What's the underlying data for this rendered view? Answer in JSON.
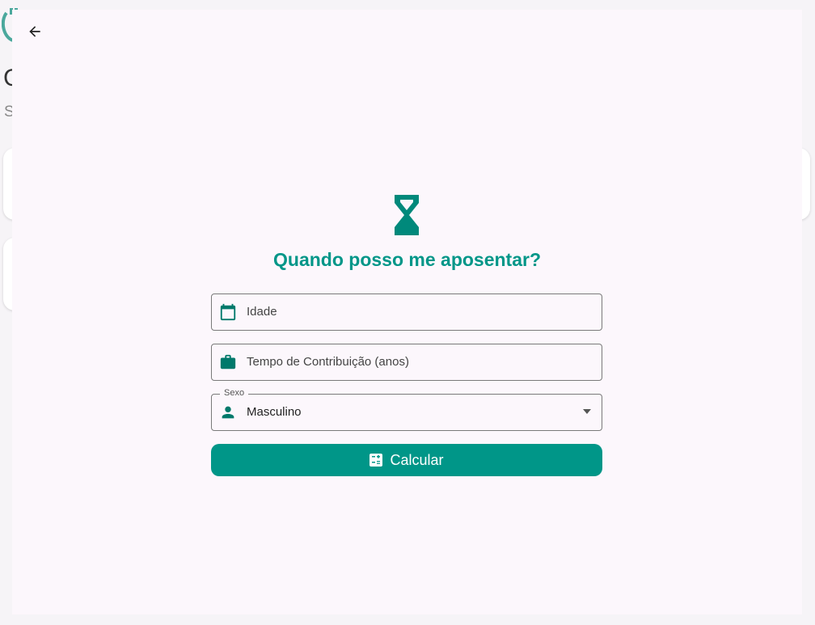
{
  "background": {
    "title_partial": "C",
    "subtitle_partial": "S"
  },
  "dialog": {
    "heading": "Quando posso me aposentar?",
    "fields": {
      "idade": {
        "placeholder": "Idade"
      },
      "tempo": {
        "placeholder": "Tempo de Contribuição (anos)"
      },
      "sexo": {
        "label": "Sexo",
        "value": "Masculino"
      }
    },
    "calculate_label": "Calcular"
  },
  "colors": {
    "accent": "#009688",
    "dialog_bg": "#fcf7fc"
  },
  "icons": {
    "back": "arrow-back-icon",
    "hero": "hourglass-icon",
    "idade": "calendar-icon",
    "tempo": "briefcase-icon",
    "sexo": "person-icon",
    "dropdown": "dropdown-arrow-icon",
    "calculate": "calculator-icon"
  }
}
